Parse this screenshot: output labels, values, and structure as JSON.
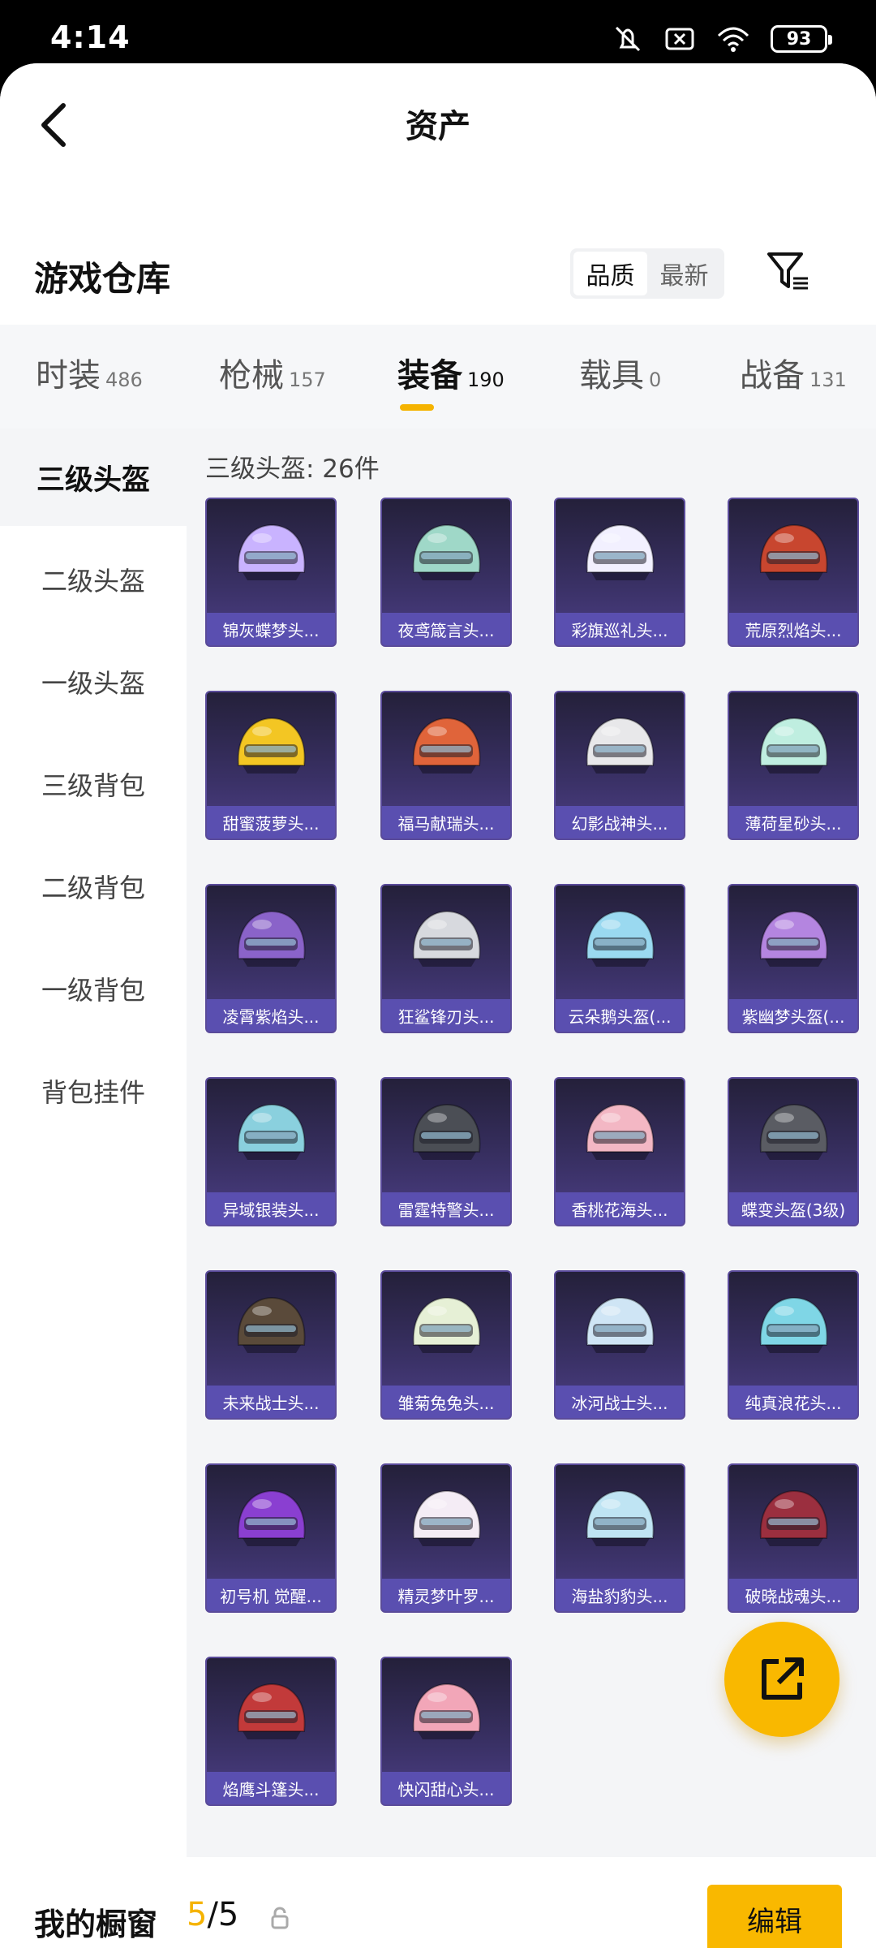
{
  "status": {
    "time": "4:14",
    "battery": "93"
  },
  "header": {
    "title": "资产"
  },
  "warehouse": {
    "title": "游戏仓库",
    "sort_options": [
      "品质",
      "最新"
    ],
    "active_sort": "品质"
  },
  "tabs": [
    {
      "label": "时装",
      "count": "486"
    },
    {
      "label": "枪械",
      "count": "157"
    },
    {
      "label": "装备",
      "count": "190"
    },
    {
      "label": "载具",
      "count": "0"
    },
    {
      "label": "战备",
      "count": "131"
    }
  ],
  "sidebar": {
    "items": [
      {
        "label": "三级头盔"
      },
      {
        "label": "二级头盔"
      },
      {
        "label": "一级头盔"
      },
      {
        "label": "三级背包"
      },
      {
        "label": "二级背包"
      },
      {
        "label": "一级背包"
      },
      {
        "label": "背包挂件"
      }
    ]
  },
  "grid": {
    "count_label": "三级头盔: 26件",
    "items": [
      {
        "label": "锦灰蝶梦头...",
        "color": "#c9b3ff"
      },
      {
        "label": "夜鸢箴言头...",
        "color": "#9fd8c8"
      },
      {
        "label": "彩旗巡礼头...",
        "color": "#f2f0ff"
      },
      {
        "label": "荒原烈焰头...",
        "color": "#c8462f"
      },
      {
        "label": "甜蜜菠萝头...",
        "color": "#f3c623"
      },
      {
        "label": "福马献瑞头...",
        "color": "#e0643a"
      },
      {
        "label": "幻影战神头...",
        "color": "#e8e8ea"
      },
      {
        "label": "薄荷星砂头...",
        "color": "#bfeee0"
      },
      {
        "label": "凌霄紫焰头...",
        "color": "#8a63c9"
      },
      {
        "label": "狂鲨锋刃头...",
        "color": "#d7d9de"
      },
      {
        "label": "云朵鹅头盔(...",
        "color": "#9ad9f0"
      },
      {
        "label": "紫幽梦头盔(...",
        "color": "#b485e0"
      },
      {
        "label": "异域银装头...",
        "color": "#8ad0de"
      },
      {
        "label": "雷霆特警头...",
        "color": "#4b4e55"
      },
      {
        "label": "香桃花海头...",
        "color": "#f3b7c4"
      },
      {
        "label": "蝶变头盔(3级)",
        "color": "#5a5c63"
      },
      {
        "label": "未来战士头...",
        "color": "#5a4a3a"
      },
      {
        "label": "雏菊兔兔头...",
        "color": "#e6f0d6"
      },
      {
        "label": "冰河战士头...",
        "color": "#cfe5f5"
      },
      {
        "label": "纯真浪花头...",
        "color": "#7fd6e6"
      },
      {
        "label": "初号机 觉醒...",
        "color": "#8a3fd1"
      },
      {
        "label": "精灵梦叶罗...",
        "color": "#f4ecf5"
      },
      {
        "label": "海盐豹豹头...",
        "color": "#bfe4f3"
      },
      {
        "label": "破晓战魂头...",
        "color": "#9b2f3f"
      },
      {
        "label": "焰鹰斗篷头...",
        "color": "#c23a3a"
      },
      {
        "label": "快闪甜心头...",
        "color": "#f2a6b8"
      }
    ]
  },
  "bottom": {
    "showcase_label": "我的橱窗",
    "showcase_current": "5",
    "showcase_total": "/5",
    "edit_label": "编辑"
  },
  "icons": {
    "back": "chevron-left-icon",
    "filter": "filter-icon",
    "fab": "external-link-icon",
    "lock": "lock-icon"
  },
  "colors": {
    "accent": "#f9b800",
    "card_label": "#5a4fb0",
    "card_bg": "#3a3166"
  }
}
